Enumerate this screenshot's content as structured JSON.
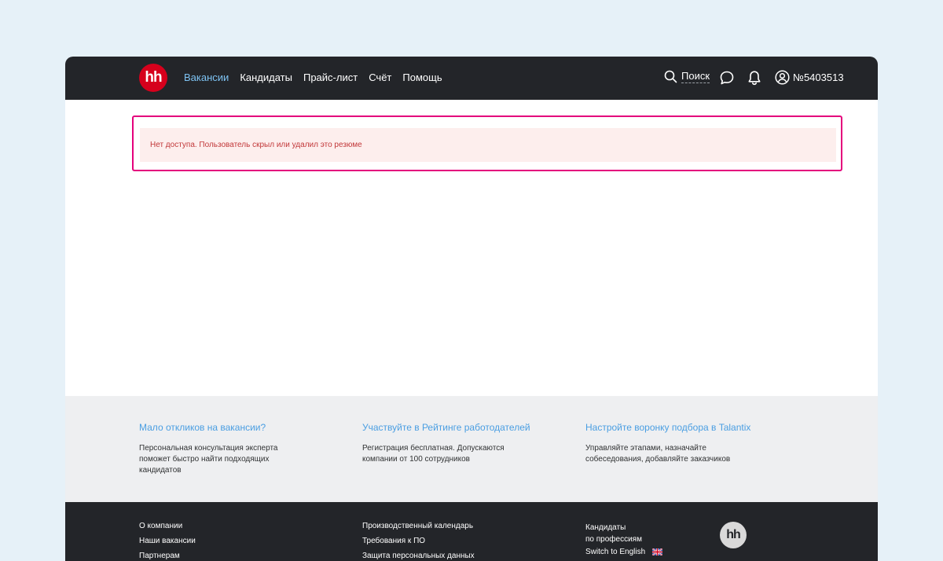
{
  "header": {
    "logo_text": "hh",
    "nav": [
      {
        "label": "Вакансии",
        "active": true
      },
      {
        "label": "Кандидаты",
        "active": false
      },
      {
        "label": "Прайс-лист",
        "active": false
      },
      {
        "label": "Счёт",
        "active": false
      },
      {
        "label": "Помощь",
        "active": false
      }
    ],
    "search_label": "Поиск",
    "account_id": "№5403513"
  },
  "alert": {
    "message": "Нет доступа. Пользователь скрыл или удалил это резюме"
  },
  "promo": [
    {
      "title": "Мало откликов на вакансии?",
      "text": "Персональная консультация эксперта поможет быстро найти подходящих кандидатов"
    },
    {
      "title": "Участвуйте в Рейтинге работодателей",
      "text": "Регистрация бесплатная. Допускаются компании от 100 сотрудников"
    },
    {
      "title": "Настройте воронку подбора в Talantix",
      "text": "Управляйте этапами, назначайте собеседования, добавляйте заказчиков"
    }
  ],
  "footer": {
    "col1": [
      "О компании",
      "Наши вакансии",
      "Партнерам"
    ],
    "col2": [
      "Производственный календарь",
      "Требования к ПО",
      "Защита персональных данных"
    ],
    "col3_candidates": [
      "Кандидаты",
      "по профессиям"
    ],
    "switch_language": "Switch to English",
    "logo_text": "hh"
  },
  "colors": {
    "header_bg": "#232529",
    "brand_red": "#d6001c",
    "nav_active": "#7ec3f3",
    "alert_bg": "#fdeeed",
    "alert_text": "#c2383a",
    "highlight": "#e4007c",
    "promo_link": "#4a9ee2"
  }
}
